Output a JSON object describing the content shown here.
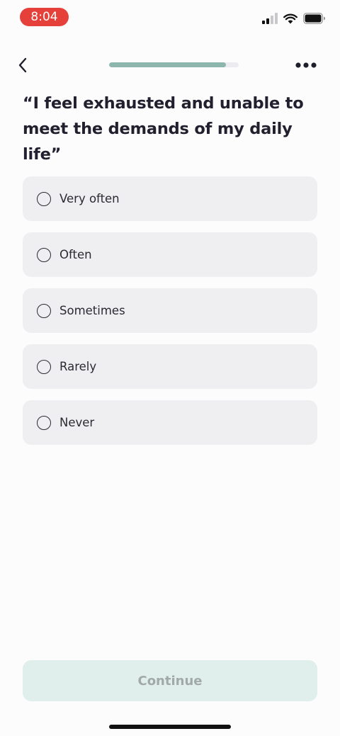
{
  "status_bar": {
    "time": "8:04",
    "time_pill_color": "#e5413a",
    "icons": [
      "signal-icon",
      "wifi-icon",
      "battery-icon"
    ]
  },
  "header": {
    "back_icon": "chevron-left-icon",
    "progress_fraction": 0.9,
    "progress_color": "#8db6ad",
    "more_icon": "more-horizontal-icon"
  },
  "question": {
    "text": "“I feel exhausted and unable to meet the demands of my daily life”"
  },
  "options": [
    {
      "label": "Very often",
      "selected": false
    },
    {
      "label": "Often",
      "selected": false
    },
    {
      "label": "Sometimes",
      "selected": false
    },
    {
      "label": "Rarely",
      "selected": false
    },
    {
      "label": "Never",
      "selected": false
    }
  ],
  "footer": {
    "continue_label": "Continue",
    "continue_enabled": false,
    "continue_color": "#e0efec"
  }
}
